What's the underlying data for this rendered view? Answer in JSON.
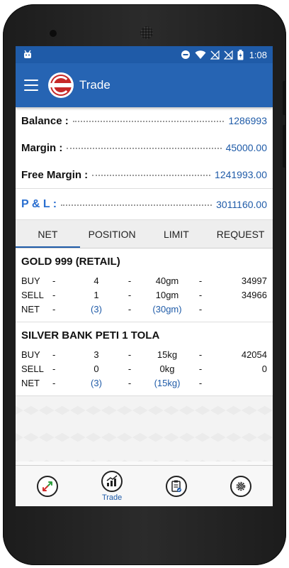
{
  "status_bar": {
    "time": "1:08"
  },
  "app_bar": {
    "title": "Trade"
  },
  "summary": {
    "balance_label": "Balance :",
    "balance_value": "1286993",
    "margin_label": "Margin :",
    "margin_value": "45000.00",
    "free_margin_label": "Free Margin :",
    "free_margin_value": "1241993.00",
    "pl_label": "P & L :",
    "pl_value": "3011160.00"
  },
  "tabs": [
    {
      "label": "NET",
      "active": true
    },
    {
      "label": "POSITION",
      "active": false
    },
    {
      "label": "LIMIT",
      "active": false
    },
    {
      "label": "REQUEST",
      "active": false
    }
  ],
  "positions": [
    {
      "title": "GOLD 999 (RETAIL)",
      "rows": [
        {
          "label": "BUY",
          "qty": "4",
          "weight": "40gm",
          "rate": "34997"
        },
        {
          "label": "SELL",
          "qty": "1",
          "weight": "10gm",
          "rate": "34966"
        },
        {
          "label": "NET",
          "qty": "(3)",
          "weight": "(30gm)",
          "rate": ""
        }
      ]
    },
    {
      "title": "SILVER BANK PETI 1 TOLA",
      "rows": [
        {
          "label": "BUY",
          "qty": "3",
          "weight": "15kg",
          "rate": "42054"
        },
        {
          "label": "SELL",
          "qty": "0",
          "weight": "0kg",
          "rate": "0"
        },
        {
          "label": "NET",
          "qty": "(3)",
          "weight": "(15kg)",
          "rate": ""
        }
      ]
    }
  ],
  "dash": "-",
  "bottom_nav": [
    {
      "icon": "swap-arrows-icon",
      "label": ""
    },
    {
      "icon": "chart-icon",
      "label": "Trade"
    },
    {
      "icon": "report-icon",
      "label": ""
    },
    {
      "icon": "settings-gear-icon",
      "label": ""
    }
  ],
  "colors": {
    "primary": "#2664b3",
    "status_bar": "#1f5ba8",
    "value_blue": "#1f5ba8",
    "pl_label": "#2a6fd0"
  }
}
